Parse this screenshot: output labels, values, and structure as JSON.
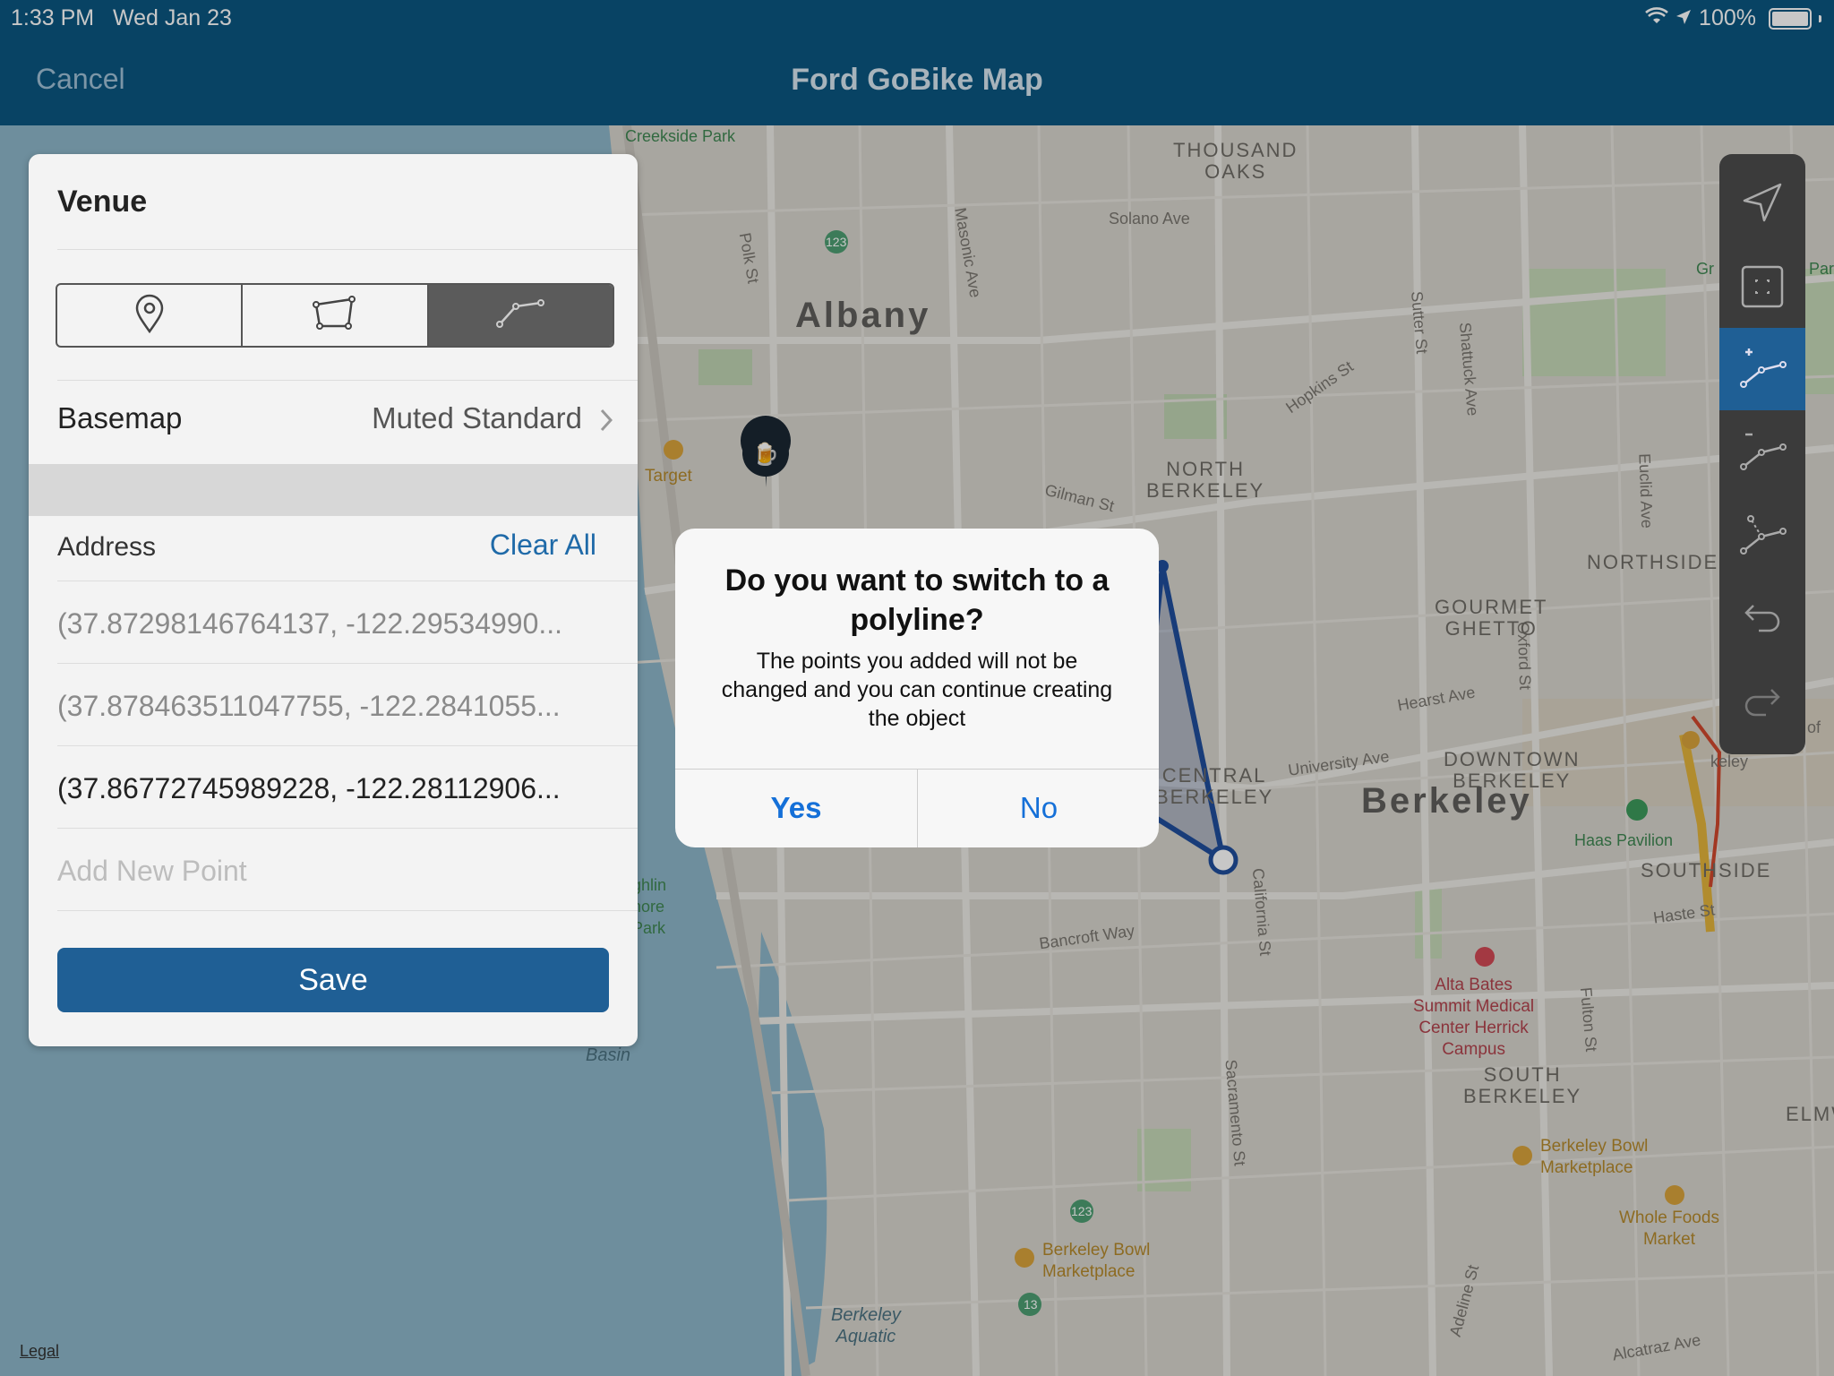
{
  "status_bar": {
    "time": "1:33 PM",
    "date": "Wed Jan 23",
    "battery": "100%"
  },
  "nav": {
    "cancel": "Cancel",
    "title": "Ford GoBike Map"
  },
  "map": {
    "labels": {
      "creekside": "Creekside Park",
      "thousand_oaks": "THOUSAND\nOAKS",
      "solano": "Solano Ave",
      "albany": "Albany",
      "polk": "Polk St",
      "masonic": "Masonic Ave",
      "sutter": "Sutter St",
      "shattuck": "Shattuck Ave",
      "hopkins": "Hopkins St",
      "north_berkeley": "NORTH\nBERKELEY",
      "gilman": "Gilman St",
      "target": "Target",
      "oxford": "Oxford St",
      "euclid": "Euclid Ave",
      "northside": "NORTHSIDE",
      "gourmet_ghetto": "GOURMET\nGHETTO",
      "hearst": "Hearst Ave",
      "central_berkeley": "CENTRAL\nBERKELEY",
      "university": "University Ave",
      "downtown_berkeley": "DOWNTOWN\nBERKELEY",
      "berkeley": "Berkeley",
      "haas": "Haas Pavilion",
      "southside": "SOUTHSIDE",
      "haste": "Haste St",
      "bancroft": "Bancroft Way",
      "california": "California St",
      "alta_bates": "Alta Bates\nSummit Medical\nCenter Herrick\nCampus",
      "fulton": "Fulton St",
      "south_berkeley": "SOUTH\nBERKELEY",
      "elmw": "ELMW",
      "sacramento": "Sacramento St",
      "bowl1": "Berkeley Bowl\nMarketplace",
      "whole_foods": "Whole Foods\nMarket",
      "bowl2": "Berkeley Bowl\nMarketplace",
      "adeline": "Adeline St",
      "alcatraz": "Alcatraz Ave",
      "aquatic": "Berkeley\nAquatic",
      "basin": "Basin",
      "shore_park": "ghlin\nhore\nPark",
      "route_123": "123",
      "route_13": "13",
      "gr": "Gr",
      "par": "Par",
      "keley": "keley",
      "of": "of"
    },
    "legal": "Legal"
  },
  "panel": {
    "title": "Venue",
    "segments": [
      {
        "icon": "pin-icon",
        "selected": false
      },
      {
        "icon": "polygon-icon",
        "selected": false
      },
      {
        "icon": "polyline-icon",
        "selected": true
      }
    ],
    "basemap_label": "Basemap",
    "basemap_value": "Muted Standard",
    "address_label": "Address",
    "clear_all": "Clear All",
    "points": [
      "(37.87298146764137, -122.29534990...",
      "(37.878463511047755, -122.2841055...",
      "(37.86772745989228, -122.28112906..."
    ],
    "add_point_placeholder": "Add New Point",
    "save": "Save"
  },
  "toolbar": {
    "tools": [
      "location-arrow-icon",
      "fit-extent-icon",
      "add-vertex-icon",
      "remove-vertex-icon",
      "insert-vertex-icon",
      "undo-icon",
      "redo-icon"
    ],
    "selected": "add-vertex-icon"
  },
  "dialog": {
    "title": "Do you want to switch to a polyline?",
    "message": "The points you added will not be changed and you can continue creating the object",
    "yes": "Yes",
    "no": "No"
  },
  "colors": {
    "nav": "#0b5680",
    "accent": "#1f5f95",
    "link": "#1570d8",
    "shape": "#1f4e9c"
  }
}
